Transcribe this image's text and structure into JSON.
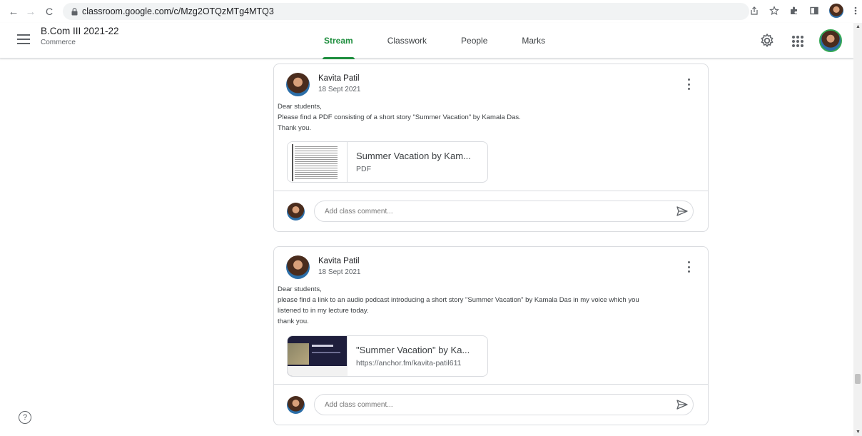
{
  "browser": {
    "back": "←",
    "forward": "→",
    "reload": "C",
    "lock": "🔒",
    "url": "classroom.google.com/c/Mzg2OTQzMTg4MTQ3",
    "icons": [
      "share-icon",
      "star-icon",
      "extensions-icon",
      "sidepanel-icon",
      "profile-icon",
      "menu-icon"
    ]
  },
  "header": {
    "title": "B.Com III 2021-22",
    "subtitle": "Commerce",
    "tabs": [
      {
        "label": "Stream",
        "active": true
      },
      {
        "label": "Classwork",
        "active": false
      },
      {
        "label": "People",
        "active": false
      },
      {
        "label": "Marks",
        "active": false
      }
    ],
    "accent_color": "#1e8e3e"
  },
  "posts": [
    {
      "author": "Kavita Patil",
      "date": "18 Sept 2021",
      "body": [
        "Dear students,",
        "Please find a PDF consisting of a short story \"Summer Vacation\" by Kamala Das.",
        "Thank you."
      ],
      "attachment": {
        "title": "Summer Vacation by Kam...",
        "subtitle": "PDF",
        "type": "pdf"
      },
      "comment_placeholder": "Add class comment..."
    },
    {
      "author": "Kavita Patil",
      "date": "18 Sept 2021",
      "body": [
        "Dear students,",
        "please find a link to an audio podcast introducing a short story \"Summer Vacation\" by Kamala Das in my voice which you",
        "listened to in my lecture today.",
        "thank you."
      ],
      "attachment": {
        "title": "\"Summer Vacation\" by Ka...",
        "subtitle": "https://anchor.fm/kavita-patil611",
        "type": "link"
      },
      "comment_placeholder": "Add class comment..."
    }
  ],
  "help": "?"
}
